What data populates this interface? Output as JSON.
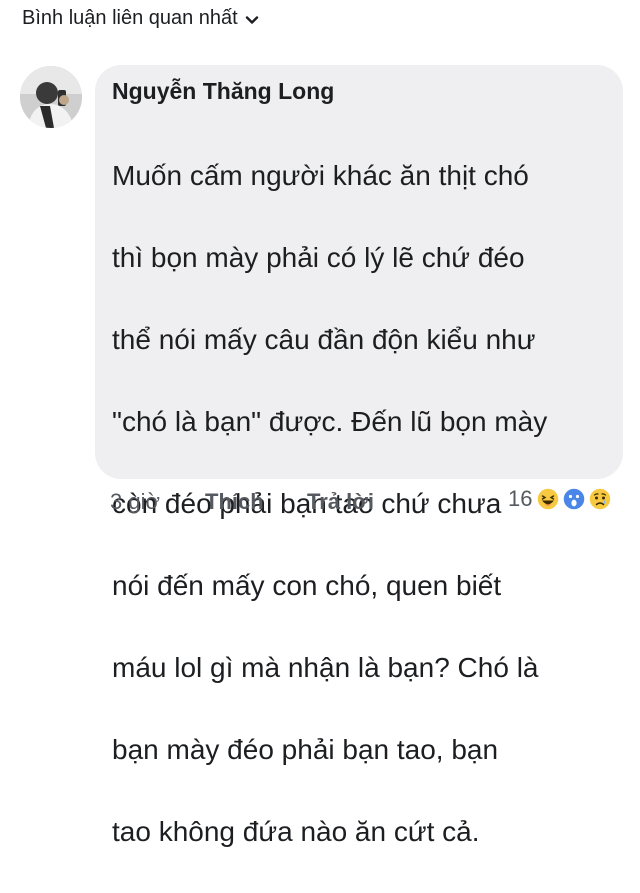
{
  "sort": {
    "label": "Bình luận liên quan nhất",
    "icon": "chevron-down-icon"
  },
  "comment": {
    "author": "Nguyễn Thăng Long",
    "avatar_icon": "user-avatar",
    "lines": [
      "Muốn cấm người khác ăn thịt chó",
      "thì bọn mày phải có lý lẽ chứ đéo",
      "thể nói mấy câu đần độn kiểu như",
      "\"chó là bạn\" được. Đến lũ bọn mày",
      "còn đéo phải bạn tao chứ chưa",
      "nói đến mấy con chó, quen biết",
      "máu lol gì mà nhận là bạn? Chó là",
      "bạn mày đéo phải bạn tao, bạn",
      "tao không đứa nào ăn cứt cả."
    ],
    "time": "3 giờ",
    "like_label": "Thích",
    "reply_label": "Trả lời",
    "reaction_count": "16",
    "reaction_icons": [
      "haha-icon",
      "wow-icon",
      "sad-icon"
    ]
  },
  "colors": {
    "bubble": "#efeff1",
    "text": "#1c1e21",
    "meta": "#555a60",
    "reaction_yellow": "#f7c940",
    "reaction_blue": "#4a86e8"
  }
}
